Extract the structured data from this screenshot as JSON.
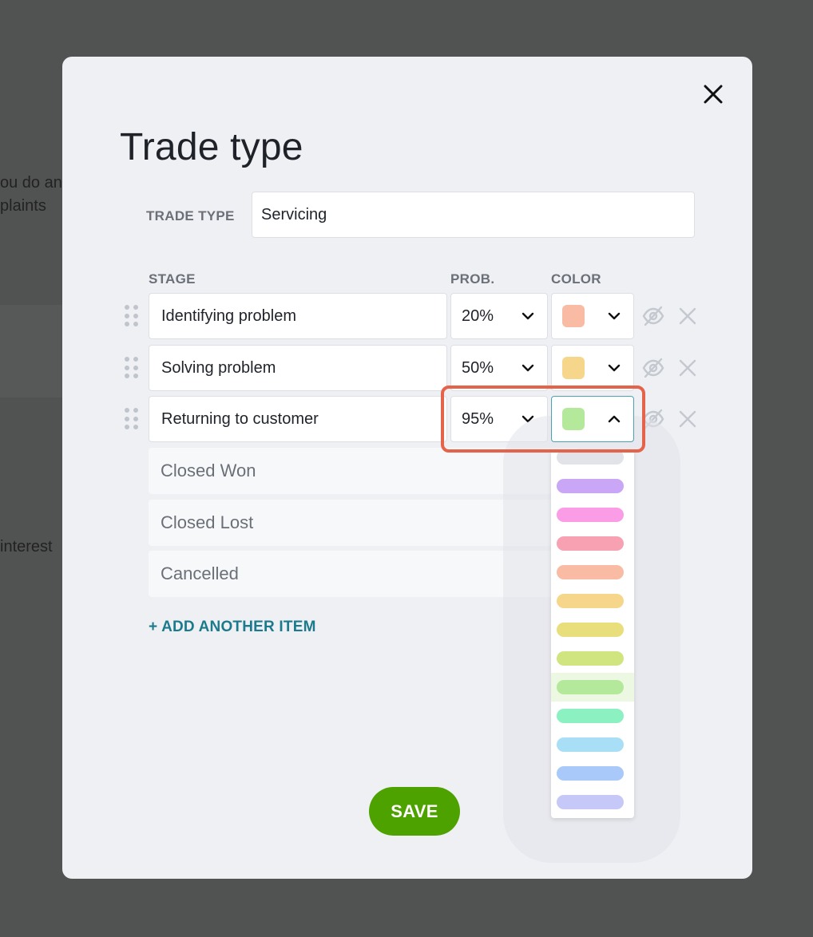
{
  "background": {
    "text_line_1": "ou do an",
    "text_line_2": "plaints",
    "text_line_3": "interest"
  },
  "modal": {
    "title": "Trade type",
    "trade_type": {
      "label": "TRADE TYPE",
      "value": "Servicing"
    },
    "columns": {
      "stage": "STAGE",
      "prob": "PROB.",
      "color": "COLOR"
    },
    "stages": [
      {
        "name": "Identifying problem",
        "prob": "20%",
        "color": "#f9bba3"
      },
      {
        "name": "Solving problem",
        "prob": "50%",
        "color": "#f6d68a"
      },
      {
        "name": "Returning to customer",
        "prob": "95%",
        "color": "#b4e99c"
      }
    ],
    "closed_stages": [
      "Closed Won",
      "Closed Lost",
      "Cancelled"
    ],
    "add_item_label": "+ ADD ANOTHER ITEM",
    "save_label": "SAVE"
  },
  "color_dropdown": {
    "options": [
      "#e1e3e8",
      "#c9a6f6",
      "#fb9de6",
      "#f8a1b2",
      "#f9bba3",
      "#f6d68a",
      "#e9de7c",
      "#d0e57f",
      "#b4e99c",
      "#8bf1c0",
      "#a8dff6",
      "#a8c9f9",
      "#c6c8f8"
    ],
    "selected_index": 8
  },
  "icons": {
    "close": "close-icon",
    "drag": "drag-handle-icon",
    "eye": "eye-off-icon",
    "remove": "remove-icon",
    "chevron": "chevron-icon"
  },
  "colors": {
    "accent": "#1b7b8c",
    "save": "#4ea200",
    "highlight": "#e5634a"
  }
}
